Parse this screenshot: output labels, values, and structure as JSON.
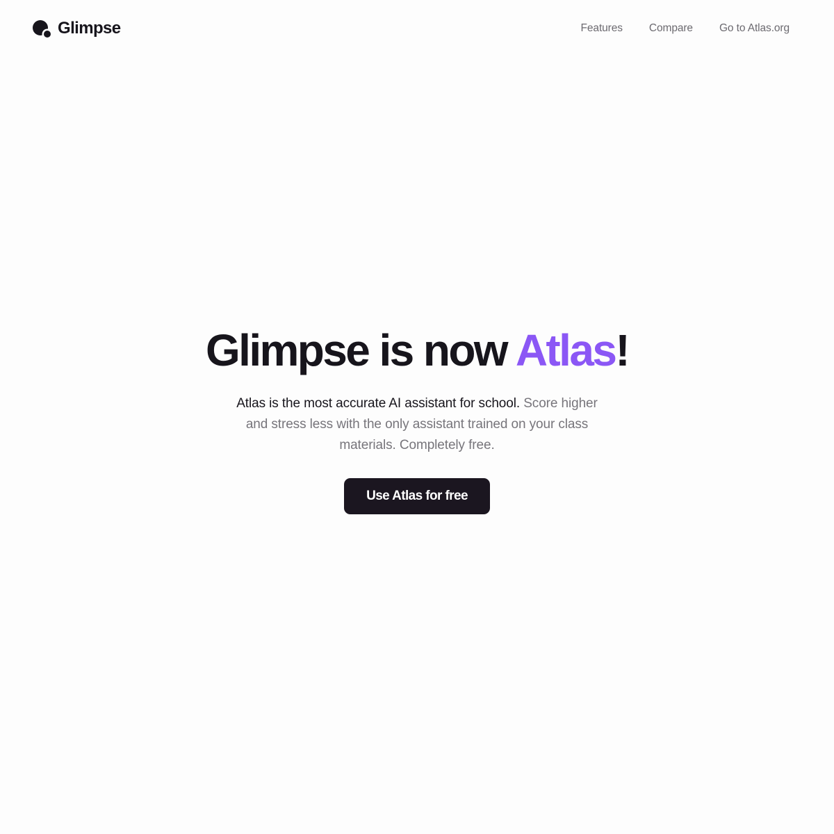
{
  "header": {
    "logo_text": "Glimpse",
    "nav": [
      {
        "label": "Features"
      },
      {
        "label": "Compare"
      },
      {
        "label": "Go to Atlas.org"
      }
    ]
  },
  "hero": {
    "title_prefix": "Glimpse is now ",
    "title_accent": "Atlas",
    "title_suffix": "!",
    "subtitle_lead": "Atlas is the most accurate AI assistant for school.",
    "subtitle_rest": " Score higher and stress less with the only assistant trained on your class materials. Completely free.",
    "cta_label": "Use Atlas for free"
  },
  "colors": {
    "accent": "#8b57f5",
    "text": "#17151c",
    "muted": "#77757b",
    "button": "#1b1620",
    "background": "#fdfdfd"
  },
  "icons": {
    "logo": "glimpse-logo-icon"
  }
}
